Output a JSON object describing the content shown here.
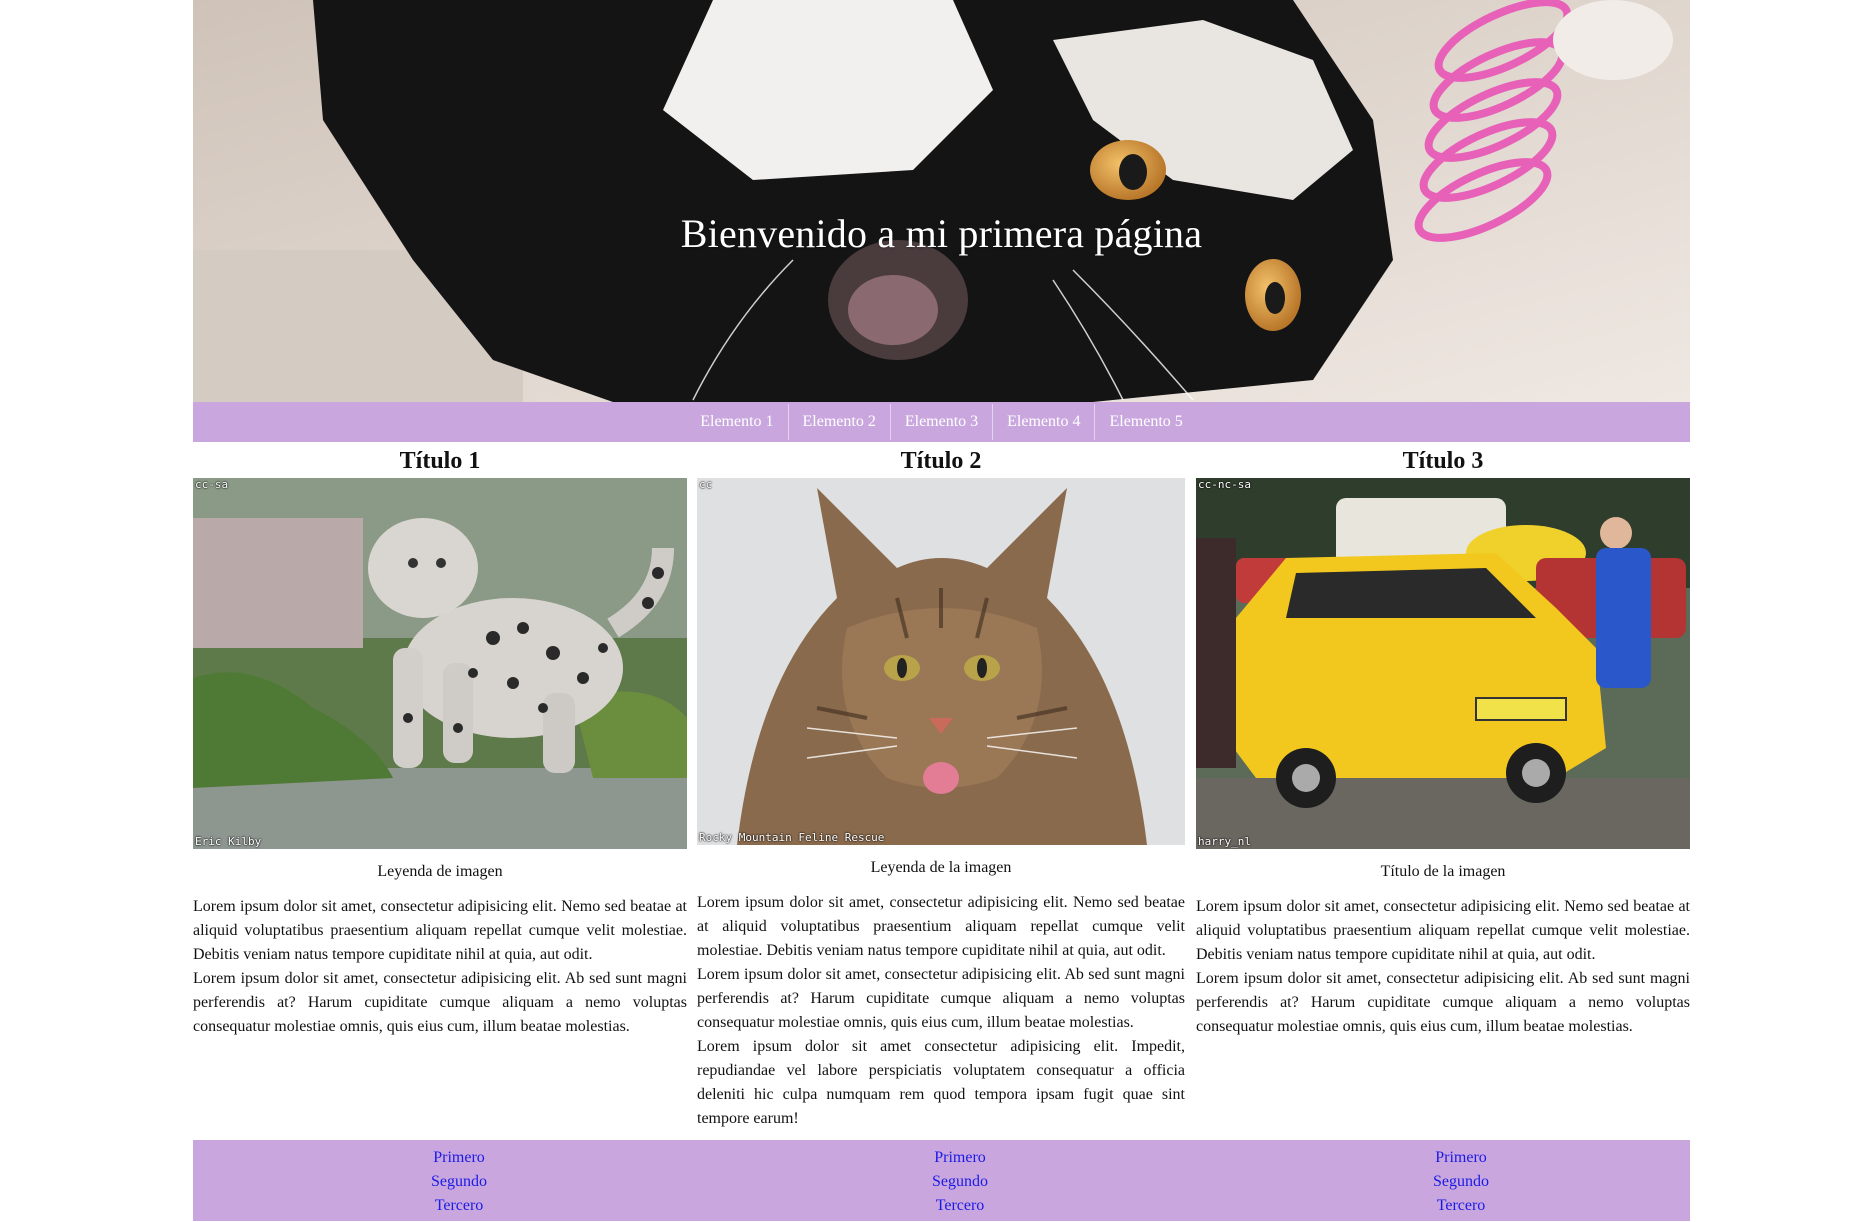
{
  "hero": {
    "title": "Bienvenido a mi primera página"
  },
  "nav": {
    "items": [
      "Elemento 1",
      "Elemento 2",
      "Elemento 3",
      "Elemento 4",
      "Elemento 5"
    ]
  },
  "columns": [
    {
      "title": "Título 1",
      "watermark_top": "cc-sa",
      "watermark_bottom": "Eric Kilby",
      "caption": "Leyenda de imagen",
      "paragraphs": [
        "Lorem ipsum dolor sit amet, consectetur adipisicing elit. Nemo sed beatae at aliquid voluptatibus praesentium aliquam repellat cumque velit molestiae. Debitis veniam natus tempore cupiditate nihil at quia, aut odit.",
        "Lorem ipsum dolor sit amet, consectetur adipisicing elit. Ab sed sunt magni perferendis at? Harum cupiditate cumque aliquam a nemo voluptas consequatur molestiae omnis, quis eius cum, illum beatae molestias."
      ]
    },
    {
      "title": "Título 2",
      "watermark_top": "cc",
      "watermark_bottom": "Rocky Mountain Feline Rescue",
      "caption": "Leyenda de la imagen",
      "paragraphs": [
        "Lorem ipsum dolor sit amet, consectetur adipisicing elit. Nemo sed beatae at aliquid voluptatibus praesentium aliquam repellat cumque velit molestiae. Debitis veniam natus tempore cupiditate nihil at quia, aut odit.",
        "Lorem ipsum dolor sit amet, consectetur adipisicing elit. Ab sed sunt magni perferendis at? Harum cupiditate cumque aliquam a nemo voluptas consequatur molestiae omnis, quis eius cum, illum beatae molestias.",
        "Lorem ipsum dolor sit amet consectetur adipisicing elit. Impedit, repudiandae vel labore perspiciatis voluptatem consequatur a officia deleniti hic culpa numquam rem quod tempora ipsam fugit quae sint tempore earum!"
      ]
    },
    {
      "title": "Título 3",
      "watermark_top": "cc-nc-sa",
      "watermark_bottom": "harry_nl",
      "caption": "Título de la imagen",
      "paragraphs": [
        "Lorem ipsum dolor sit amet, consectetur adipisicing elit. Nemo sed beatae at aliquid voluptatibus praesentium aliquam repellat cumque velit molestiae. Debitis veniam natus tempore cupiditate nihil at quia, aut odit.",
        "Lorem ipsum dolor sit amet, consectetur adipisicing elit. Ab sed sunt magni perferendis at? Harum cupiditate cumque aliquam a nemo voluptas consequatur molestiae omnis, quis eius cum, illum beatae molestias."
      ]
    }
  ],
  "footer": {
    "columns": [
      [
        "Primero",
        "Segundo",
        "Tercero"
      ],
      [
        "Primero",
        "Segundo",
        "Tercero"
      ],
      [
        "Primero",
        "Segundo",
        "Tercero"
      ]
    ]
  },
  "colors": {
    "accent_purple": "#c9a7de",
    "link_blue": "#1a1ae6",
    "nav_text": "#ffffff"
  }
}
